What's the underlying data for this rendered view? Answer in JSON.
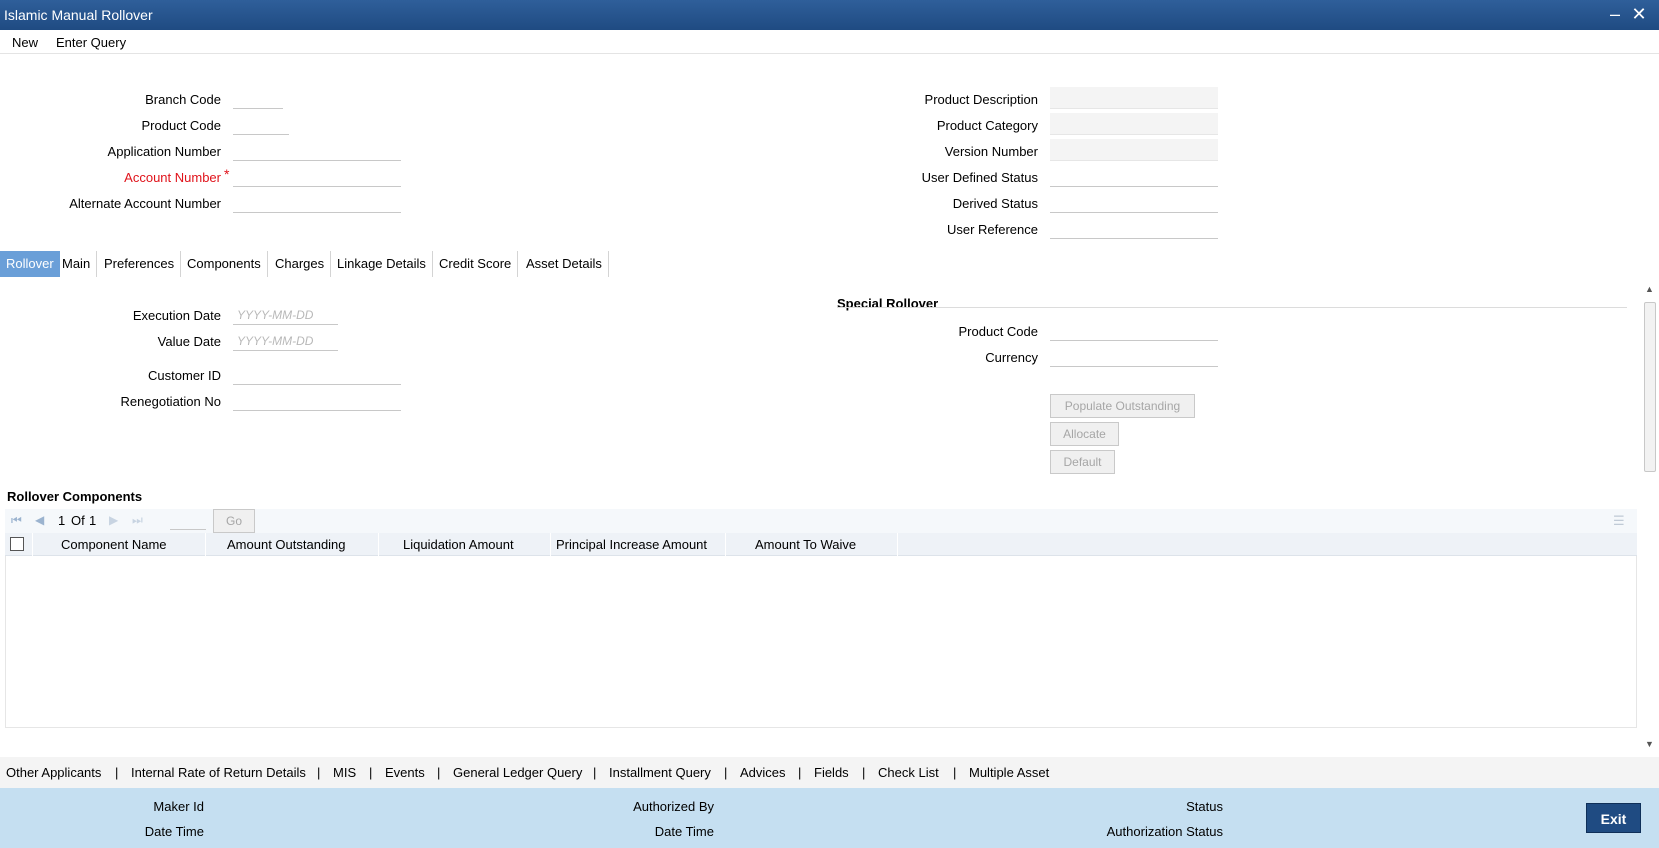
{
  "window": {
    "title": "Islamic Manual Rollover"
  },
  "menu": {
    "new": "New",
    "enter_query": "Enter Query"
  },
  "header": {
    "branch_code": {
      "label": "Branch Code",
      "value": ""
    },
    "product_code": {
      "label": "Product Code",
      "value": ""
    },
    "application_number": {
      "label": "Application Number",
      "value": ""
    },
    "account_number": {
      "label": "Account Number",
      "value": "",
      "required_mark": "*"
    },
    "alternate_account_number": {
      "label": "Alternate Account Number",
      "value": ""
    },
    "product_description": {
      "label": "Product Description",
      "value": ""
    },
    "product_category": {
      "label": "Product Category",
      "value": ""
    },
    "version_number": {
      "label": "Version Number",
      "value": ""
    },
    "user_defined_status": {
      "label": "User Defined Status",
      "value": ""
    },
    "derived_status": {
      "label": "Derived Status",
      "value": ""
    },
    "user_reference": {
      "label": "User Reference",
      "value": ""
    }
  },
  "tabs": [
    "Rollover",
    "Main",
    "Preferences",
    "Components",
    "Charges",
    "Linkage Details",
    "Credit Score",
    "Asset Details"
  ],
  "active_tab": "Rollover",
  "rollover": {
    "execution_date": {
      "label": "Execution Date",
      "placeholder": "YYYY-MM-DD"
    },
    "value_date": {
      "label": "Value Date",
      "placeholder": "YYYY-MM-DD"
    },
    "customer_id": {
      "label": "Customer ID",
      "value": ""
    },
    "renegotiation_no": {
      "label": "Renegotiation No",
      "value": ""
    }
  },
  "special_rollover": {
    "title": "Special Rollover",
    "product_code": {
      "label": "Product Code",
      "value": ""
    },
    "currency": {
      "label": "Currency",
      "value": ""
    },
    "buttons": {
      "populate": "Populate Outstanding",
      "allocate": "Allocate",
      "default": "Default"
    }
  },
  "rollover_components": {
    "title": "Rollover Components",
    "pagination": {
      "current": "1",
      "of": "Of",
      "total": "1",
      "go": "Go"
    },
    "columns": [
      "Component Name",
      "Amount Outstanding",
      "Liquidation Amount",
      "Principal Increase Amount",
      "Amount To Waive"
    ],
    "rows": []
  },
  "links": [
    "Other Applicants",
    "Internal Rate of Return Details",
    "MIS",
    "Events",
    "General Ledger Query",
    "Installment Query",
    "Advices",
    "Fields",
    "Check List",
    "Multiple Asset"
  ],
  "footer": {
    "maker_id": "Maker Id",
    "date_time_1": "Date Time",
    "authorized_by": "Authorized By",
    "date_time_2": "Date Time",
    "status": "Status",
    "authorization_status": "Authorization Status",
    "exit": "Exit"
  },
  "colors": {
    "title_bar": "#2f5f9a",
    "active_tab": "#6a9fd8",
    "footer": "#c5dff1",
    "required": "#e0131b"
  }
}
